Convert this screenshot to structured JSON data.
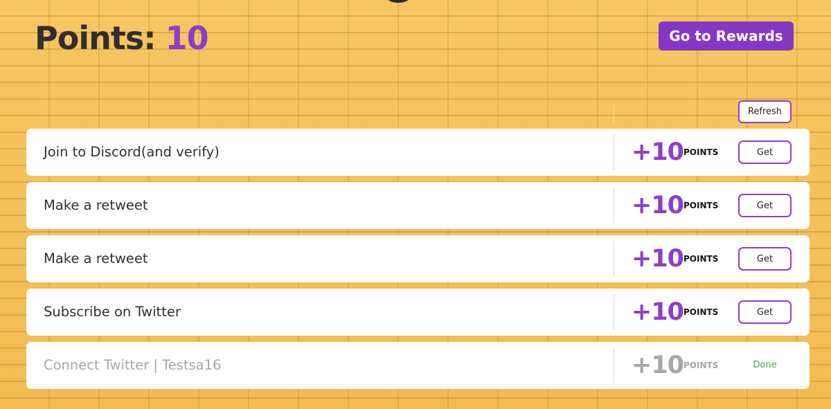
{
  "header": {
    "points_label": "Points:",
    "points_value": "10",
    "rewards_button": "Go to Rewards",
    "refresh_button": "Refresh"
  },
  "colors": {
    "accent": "#8d3ec8",
    "background": "#f5bf57",
    "done": "#3cb043",
    "muted": "#a6a6a6"
  },
  "tasks": [
    {
      "title": "Join to Discord(and verify)",
      "amount": "+10",
      "unit": "POINTS",
      "action": "Get"
    },
    {
      "title": "Make a retweet",
      "amount": "+10",
      "unit": "POINTS",
      "action": "Get"
    },
    {
      "title": "Make a retweet",
      "amount": "+10",
      "unit": "POINTS",
      "action": "Get"
    },
    {
      "title": "Subscribe on Twitter",
      "amount": "+10",
      "unit": "POINTS",
      "action": "Get"
    },
    {
      "title": "Connect Twitter | Testsa16",
      "amount": "+10",
      "unit": "POINTS",
      "status": "Done"
    }
  ]
}
